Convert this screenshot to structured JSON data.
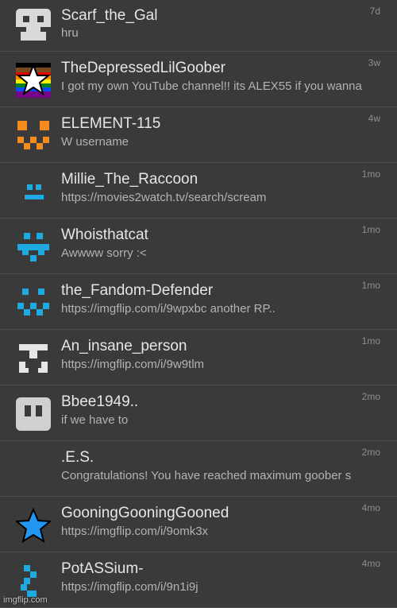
{
  "conversations": [
    {
      "name": "Scarf_the_Gal",
      "preview": "hru",
      "time": "7d",
      "avatar_icon": "gray-pixel-face-icon",
      "avatar_color": "#d9d9d9"
    },
    {
      "name": "TheDepressedLilGoober",
      "preview": "I got my own YouTube channel!! its ALEX55 if you wanna",
      "time": "3w",
      "avatar_icon": "rainbow-star-icon",
      "avatar_color": "#ffffff"
    },
    {
      "name": "ELEMENT-115",
      "preview": "W username",
      "time": "4w",
      "avatar_icon": "orange-pixel-face-icon",
      "avatar_color": "#f58a1f"
    },
    {
      "name": "Millie_The_Raccoon",
      "preview": "https://movies2watch.tv/search/scream",
      "time": "1mo",
      "avatar_icon": "blue-pixel-face-icon",
      "avatar_color": "#1fa9e1"
    },
    {
      "name": "Whoisthatcat",
      "preview": "Awwww sorry :<",
      "time": "1mo",
      "avatar_icon": "blue-pixel-cat-icon",
      "avatar_color": "#1fa9e1"
    },
    {
      "name": "the_Fandom-Defender",
      "preview": "https://imgflip.com/i/9wpxbc another RP..",
      "time": "1mo",
      "avatar_icon": "blue-pixel-smile-icon",
      "avatar_color": "#1fa9e1"
    },
    {
      "name": "An_insane_person",
      "preview": "https://imgflip.com/i/9w9tlm",
      "time": "1mo",
      "avatar_icon": "white-pixel-face-icon",
      "avatar_color": "#e6e6e6"
    },
    {
      "name": "Bbee1949..",
      "preview": "if we have to",
      "time": "2mo",
      "avatar_icon": "gray-pixel-block-icon",
      "avatar_color": "#d0d0d0"
    },
    {
      "name": ".E.S.",
      "preview": "Congratulations! You have reached maximum goober s",
      "time": "2mo",
      "avatar_icon": "",
      "avatar_color": ""
    },
    {
      "name": "GooningGooningGooned",
      "preview": "https://imgflip.com/i/9omk3x",
      "time": "4mo",
      "avatar_icon": "blue-star-icon",
      "avatar_color": "#2196f3"
    },
    {
      "name": "PotASSium-",
      "preview": "https://imgflip.com/i/9n1i9j",
      "time": "4mo",
      "avatar_icon": "blue-pixel-swirl-icon",
      "avatar_color": "#1fa9e1"
    }
  ],
  "watermark": "imgflip.com"
}
